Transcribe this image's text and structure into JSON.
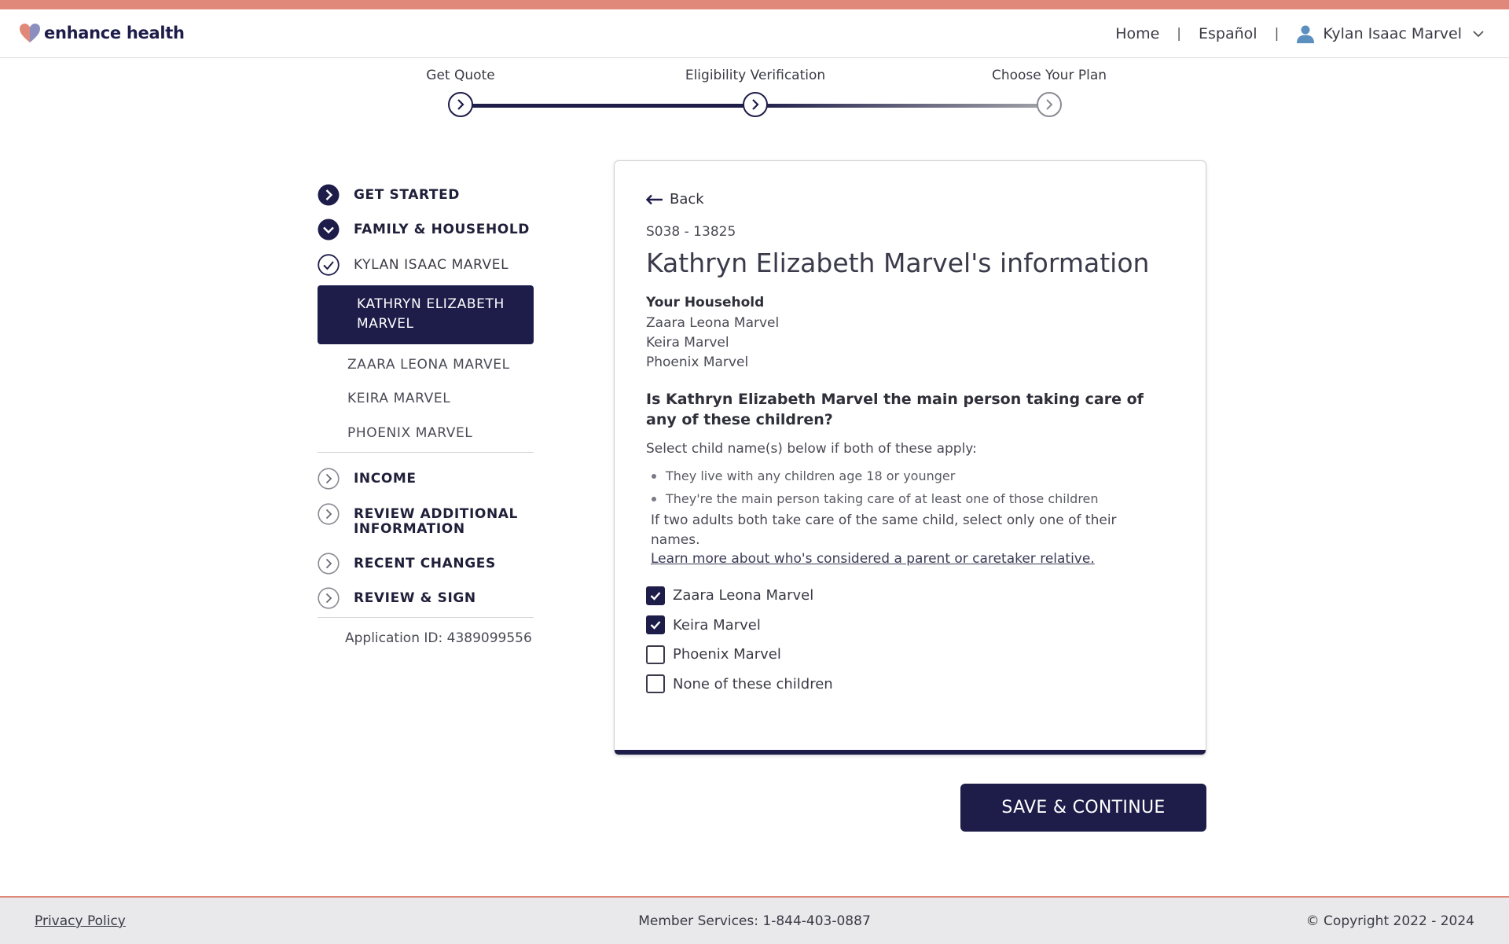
{
  "header": {
    "brand": "enhance health",
    "nav": {
      "home": "Home",
      "language": "Español",
      "user": "Kylan Isaac Marvel"
    }
  },
  "stepper": {
    "steps": [
      {
        "label": "Get Quote",
        "state": "complete"
      },
      {
        "label": "Eligibility Verification",
        "state": "current"
      },
      {
        "label": "Choose Your Plan",
        "state": "upcoming"
      }
    ]
  },
  "sidebar": {
    "sections": [
      {
        "label": "GET STARTED",
        "state": "complete"
      },
      {
        "label": "FAMILY & HOUSEHOLD",
        "state": "expanded"
      },
      {
        "label": "INCOME",
        "state": "upcoming"
      },
      {
        "label": "REVIEW ADDITIONAL INFORMATION",
        "state": "upcoming"
      },
      {
        "label": "RECENT CHANGES",
        "state": "upcoming"
      },
      {
        "label": "REVIEW & SIGN",
        "state": "upcoming"
      }
    ],
    "members": [
      {
        "label": "KYLAN ISAAC MARVEL",
        "state": "complete"
      },
      {
        "label": "KATHRYN ELIZABETH MARVEL",
        "state": "active"
      },
      {
        "label": "ZAARA LEONA MARVEL",
        "state": "pending"
      },
      {
        "label": "KEIRA MARVEL",
        "state": "pending"
      },
      {
        "label": "PHOENIX MARVEL",
        "state": "pending"
      }
    ],
    "application_id": "Application ID: 4389099556"
  },
  "card": {
    "back": "Back",
    "case_id": "S038 - 13825",
    "title": "Kathryn Elizabeth Marvel's information",
    "household_title": "Your Household",
    "household": [
      "Zaara Leona Marvel",
      "Keira Marvel",
      "Phoenix Marvel"
    ],
    "question": "Is Kathryn Elizabeth Marvel the main person taking care of any of these children?",
    "instruction": "Select child name(s) below if both of these apply:",
    "bullets": [
      "They live with any children age 18 or younger",
      "They're the main person taking care of at least one of those children"
    ],
    "note": "If two adults both take care of the same child, select only one of their names.",
    "learn_more": "Learn more about who's considered a parent or caretaker relative.",
    "options": [
      {
        "label": "Zaara Leona Marvel",
        "checked": true
      },
      {
        "label": "Keira Marvel",
        "checked": true
      },
      {
        "label": "Phoenix Marvel",
        "checked": false
      },
      {
        "label": "None of these children",
        "checked": false
      }
    ]
  },
  "actions": {
    "save": "SAVE & CONTINUE"
  },
  "footer": {
    "privacy": "Privacy Policy",
    "services": "Member Services: 1-844-403-0887",
    "copyright": "© Copyright 2022 - 2024"
  },
  "colors": {
    "navy": "#1e1d4a",
    "accent": "#e0897a",
    "user_icon": "#5b8fbf"
  }
}
